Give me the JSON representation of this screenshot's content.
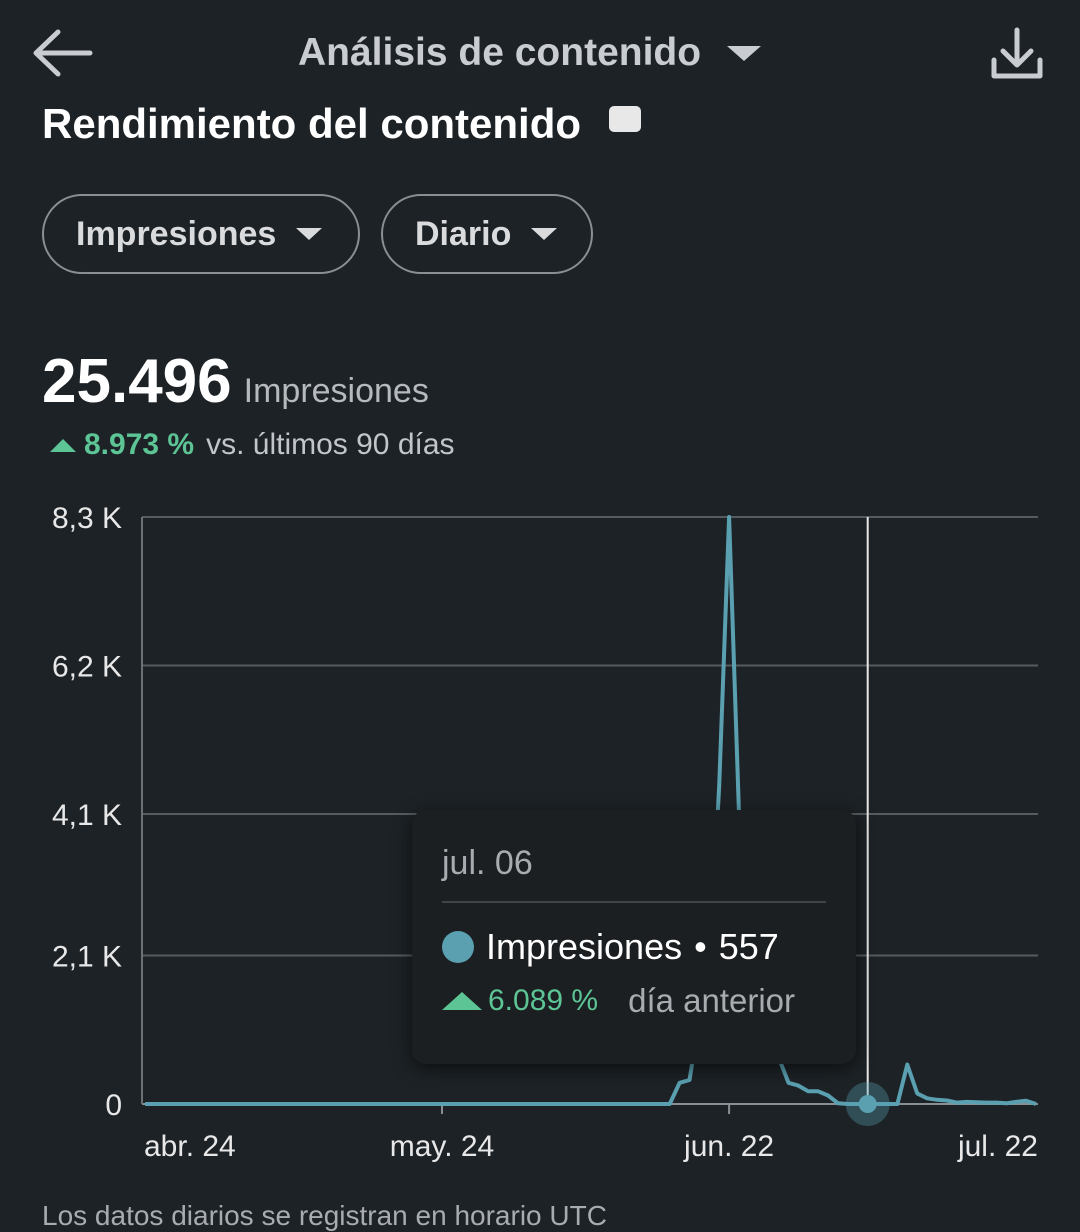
{
  "header": {
    "title": "Análisis de contenido",
    "back_icon": "arrow-left-icon",
    "download_icon": "download-icon"
  },
  "section": {
    "title": "Rendimiento del contenido",
    "info_icon": "info-icon"
  },
  "filters": {
    "metric": "Impresiones",
    "period": "Diario"
  },
  "summary": {
    "value": "25.496",
    "unit": "Impresiones",
    "change_pct": "8.973 %",
    "change_text": "vs. últimos 90 días"
  },
  "colors": {
    "background": "#1d2226",
    "line": "#5aa0b1",
    "positive": "#5cc495",
    "grid": "#555b5f"
  },
  "chart_data": {
    "type": "line",
    "series_name": "Impresiones",
    "y_ticks": [
      "8,3 K",
      "6,2 K",
      "4,1 K",
      "2,1 K",
      "0"
    ],
    "y_tick_values": [
      8300,
      6200,
      4100,
      2100,
      0
    ],
    "ylim": [
      0,
      8300
    ],
    "x_ticks": [
      "abr. 24",
      "may. 24",
      "jun. 22",
      "jul. 22"
    ],
    "x_tick_days": [
      0,
      30,
      59,
      89
    ],
    "values": [
      0,
      0,
      0,
      0,
      0,
      0,
      0,
      0,
      0,
      0,
      0,
      0,
      0,
      0,
      0,
      0,
      0,
      0,
      0,
      0,
      0,
      0,
      0,
      0,
      0,
      0,
      0,
      0,
      0,
      0,
      0,
      0,
      0,
      0,
      0,
      0,
      0,
      0,
      0,
      0,
      0,
      0,
      0,
      0,
      0,
      0,
      0,
      0,
      0,
      0,
      0,
      0,
      0,
      0,
      300,
      340,
      1200,
      1900,
      4500,
      8300,
      4100,
      1300,
      700,
      600,
      660,
      300,
      260,
      180,
      180,
      120,
      10,
      0,
      0,
      0,
      0,
      0,
      0,
      557,
      150,
      80,
      60,
      50,
      20,
      30,
      25,
      20,
      20,
      10,
      30,
      45,
      0
    ],
    "selected_index": 73,
    "grid": true,
    "legend": "none"
  },
  "tooltip": {
    "date": "jul. 06",
    "series": "Impresiones",
    "value": "557",
    "change_pct": "6.089 %",
    "change_label": "día anterior"
  },
  "footnote": "Los datos diarios se registran en horario UTC"
}
